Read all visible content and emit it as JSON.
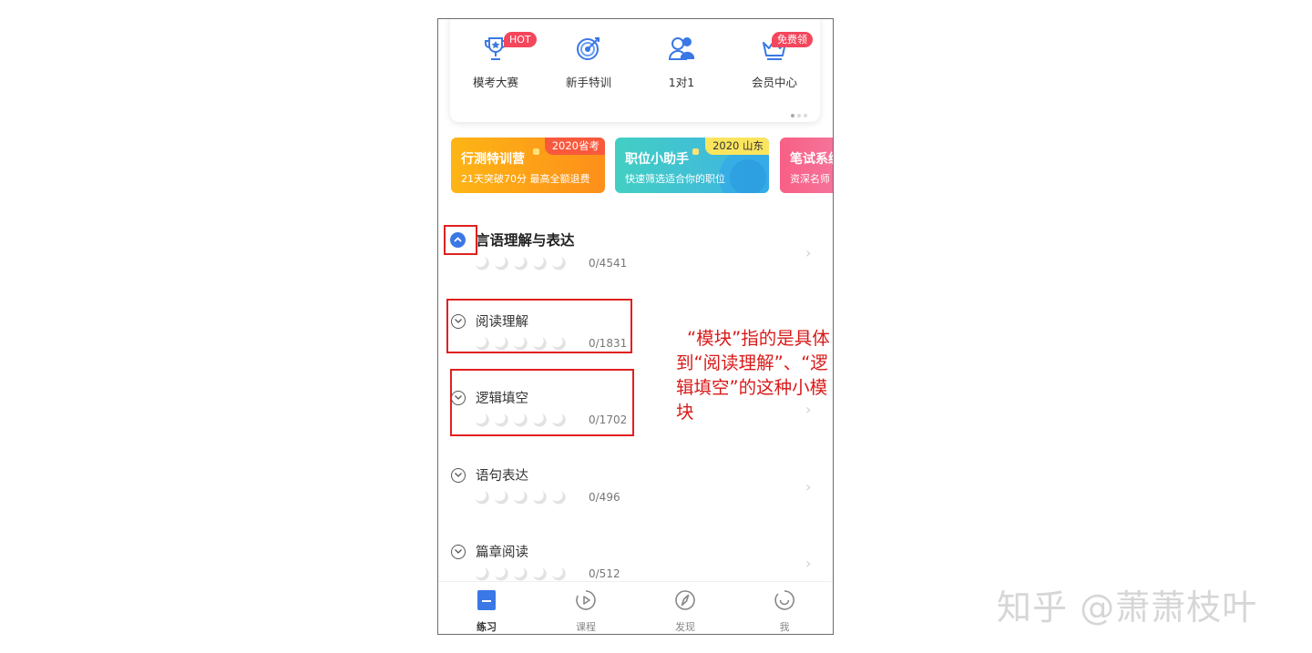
{
  "features": [
    {
      "label": "模考大赛",
      "icon": "trophy-icon",
      "badge": "HOT"
    },
    {
      "label": "新手特训",
      "icon": "target-icon",
      "badge": ""
    },
    {
      "label": "1对1",
      "icon": "tutor-icon",
      "badge": ""
    },
    {
      "label": "会员中心",
      "icon": "crown-basket-icon",
      "badge": "免费领"
    }
  ],
  "banners": [
    {
      "title": "行测特训营",
      "subtitle": "21天突破70分 最高全额退费",
      "tag": "2020省考"
    },
    {
      "title": "职位小助手",
      "subtitle": "快速筛选适合你的职位",
      "tag": "2020 山东"
    },
    {
      "title": "笔试系统",
      "subtitle": "资深名师",
      "tag": ""
    }
  ],
  "list": {
    "main": {
      "title": "言语理解与表达",
      "count": "0/4541"
    },
    "items": [
      {
        "title": "阅读理解",
        "count": "0/1831"
      },
      {
        "title": "逻辑填空",
        "count": "0/1702"
      },
      {
        "title": "语句表达",
        "count": "0/496"
      },
      {
        "title": "篇章阅读",
        "count": "0/512"
      }
    ]
  },
  "tabs": [
    {
      "label": "练习",
      "icon": "practice-book-icon"
    },
    {
      "label": "课程",
      "icon": "play-circle-icon"
    },
    {
      "label": "发现",
      "icon": "compass-icon"
    },
    {
      "label": "我",
      "icon": "smile-icon"
    }
  ],
  "annotation": "“模块”指的是具体到“阅读理解”、“逻辑填空”的这种小模块",
  "watermark": "知乎 @萧萧枝叶",
  "colors": {
    "accent": "#3a78e6",
    "annotation_red": "#e02020",
    "badge_red": "#f4465c"
  }
}
